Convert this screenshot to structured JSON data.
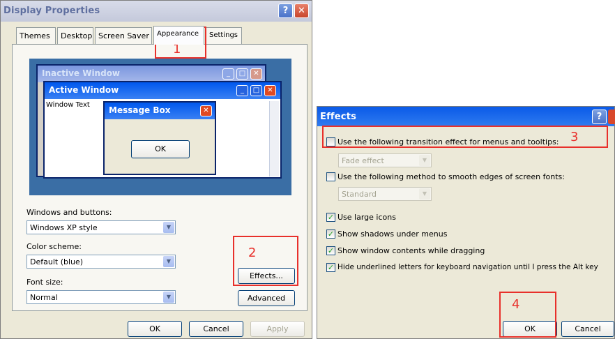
{
  "display_properties": {
    "title": "Display Properties",
    "help": "?",
    "close": "✕",
    "tabs": [
      "Themes",
      "Desktop",
      "Screen Saver",
      "Appearance",
      "Settings"
    ],
    "preview": {
      "inactive_title": "Inactive Window",
      "active_title": "Active Window",
      "window_text": "Window Text",
      "message_box_title": "Message Box",
      "ok": "OK"
    },
    "windows_buttons_label": "Windows and buttons:",
    "windows_buttons_value": "Windows XP style",
    "color_scheme_label": "Color scheme:",
    "color_scheme_value": "Default (blue)",
    "font_size_label": "Font size:",
    "font_size_value": "Normal",
    "effects_button": "Effects...",
    "advanced_button": "Advanced",
    "ok": "OK",
    "cancel": "Cancel",
    "apply": "Apply"
  },
  "effects": {
    "title": "Effects",
    "help": "?",
    "options": [
      {
        "label": "Use the following transition effect for menus and tooltips:",
        "checked": false
      },
      {
        "label": "Use the following method to smooth edges of screen fonts:",
        "checked": false
      },
      {
        "label": "Use large icons",
        "checked": true
      },
      {
        "label": "Show shadows under menus",
        "checked": true
      },
      {
        "label": "Show window contents while dragging",
        "checked": true
      },
      {
        "label": "Hide underlined letters for keyboard navigation until I press the Alt key",
        "checked": true
      }
    ],
    "transition_value": "Fade effect",
    "smoothing_value": "Standard",
    "ok": "OK",
    "cancel": "Cancel"
  },
  "annotations": [
    "1",
    "2",
    "3",
    "4"
  ],
  "colors": {
    "marker": "#e8302b",
    "xp_blue": "#0058ee",
    "dialog_bg": "#ECE9D8"
  }
}
